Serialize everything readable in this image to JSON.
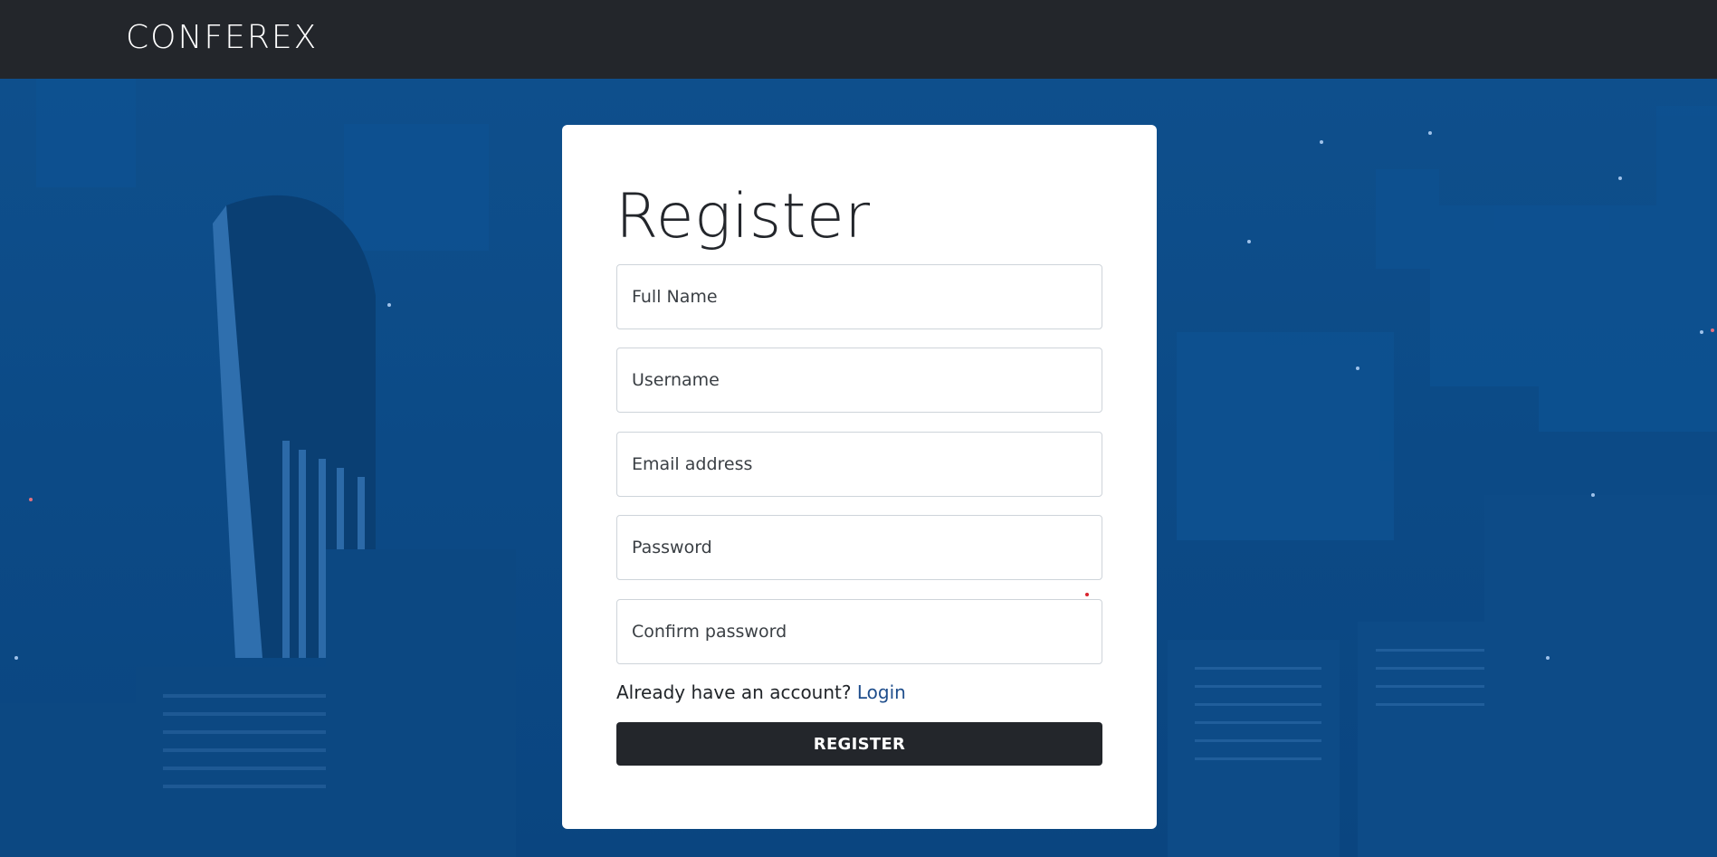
{
  "navbar": {
    "brand": "CONFEREX"
  },
  "form": {
    "title": "Register",
    "fields": [
      {
        "name": "full_name",
        "placeholder": "Full Name",
        "value": ""
      },
      {
        "name": "username",
        "placeholder": "Username",
        "value": ""
      },
      {
        "name": "email",
        "placeholder": "Email address",
        "value": ""
      },
      {
        "name": "password",
        "placeholder": "Password",
        "value": ""
      },
      {
        "name": "confirm_password",
        "placeholder": "Confirm password",
        "value": ""
      }
    ],
    "login_prompt": "Already have an account?",
    "login_link": "Login",
    "submit_label": "REGISTER"
  },
  "colors": {
    "navbar_bg": "#23262b",
    "hero_bg": "#0b4a85",
    "card_bg": "#ffffff",
    "button_bg": "#23262b",
    "link": "#1f4e8c"
  }
}
